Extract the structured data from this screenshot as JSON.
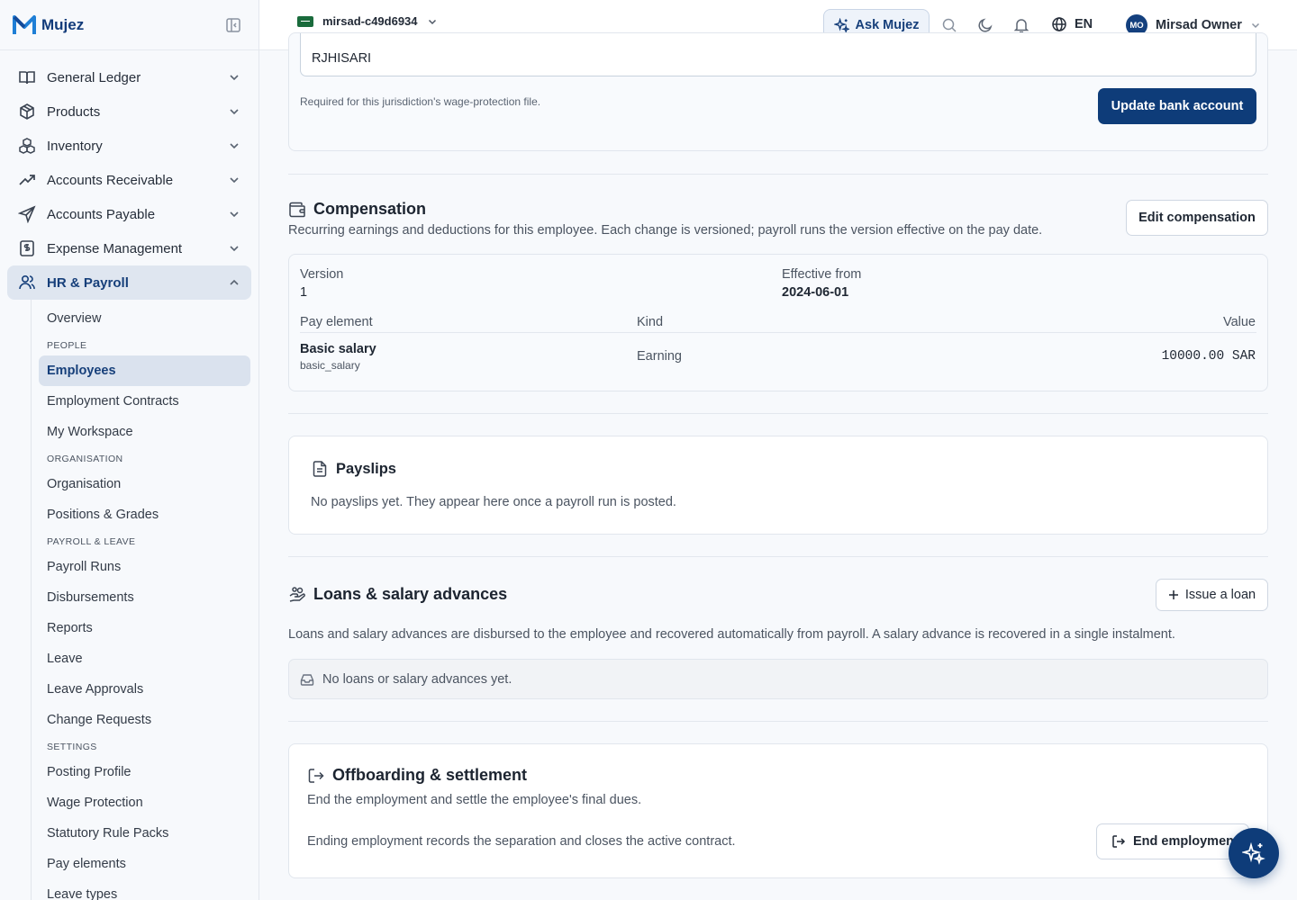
{
  "brand": {
    "name": "Mujez"
  },
  "sidebar": {
    "items": [
      {
        "label": "General Ledger"
      },
      {
        "label": "Products"
      },
      {
        "label": "Inventory"
      },
      {
        "label": "Accounts Receivable"
      },
      {
        "label": "Accounts Payable"
      },
      {
        "label": "Expense Management"
      },
      {
        "label": "HR & Payroll"
      }
    ],
    "hr": {
      "overview": "Overview",
      "people_heading": "PEOPLE",
      "employees": "Employees",
      "employment_contracts": "Employment Contracts",
      "my_workspace": "My Workspace",
      "organisation_heading": "ORGANISATION",
      "organisation": "Organisation",
      "positions_grades": "Positions & Grades",
      "payroll_heading": "PAYROLL & LEAVE",
      "payroll_runs": "Payroll Runs",
      "disbursements": "Disbursements",
      "reports": "Reports",
      "leave": "Leave",
      "leave_approvals": "Leave Approvals",
      "change_requests": "Change Requests",
      "settings_heading": "SETTINGS",
      "posting_profile": "Posting Profile",
      "wage_protection": "Wage Protection",
      "statutory_rule_packs": "Statutory Rule Packs",
      "pay_elements": "Pay elements",
      "leave_types": "Leave types"
    }
  },
  "topbar": {
    "workspace": "mirsad-c49d6934",
    "ask_label": "Ask Mujez",
    "language": "EN",
    "user_initials": "MO",
    "user_name": "Mirsad Owner"
  },
  "bank": {
    "value": "RJHISARI",
    "help": "Required for this jurisdiction's wage-protection file.",
    "update_button": "Update bank account"
  },
  "compensation": {
    "title": "Compensation",
    "description": "Recurring earnings and deductions for this employee. Each change is versioned; payroll runs the version effective on the pay date.",
    "edit_button": "Edit compensation",
    "version_label": "Version",
    "version_value": "1",
    "effective_label": "Effective from",
    "effective_value": "2024-06-01",
    "columns": {
      "element": "Pay element",
      "kind": "Kind",
      "value": "Value"
    },
    "rows": [
      {
        "name": "Basic salary",
        "code": "basic_salary",
        "kind": "Earning",
        "value": "10000.00 SAR"
      }
    ]
  },
  "payslips": {
    "title": "Payslips",
    "empty": "No payslips yet. They appear here once a payroll run is posted."
  },
  "loans": {
    "title": "Loans & salary advances",
    "issue_button": "Issue a loan",
    "description": "Loans and salary advances are disbursed to the employee and recovered automatically from payroll. A salary advance is recovered in a single instalment.",
    "empty": "No loans or salary advances yet."
  },
  "offboarding": {
    "title": "Offboarding & settlement",
    "description": "End the employment and settle the employee's final dues.",
    "note": "Ending employment records the separation and closes the active contract.",
    "end_button": "End employment"
  },
  "colors": {
    "primary": "#0e3c79",
    "active_bg": "#dfe6f0",
    "flag": "#1a6b3c"
  }
}
